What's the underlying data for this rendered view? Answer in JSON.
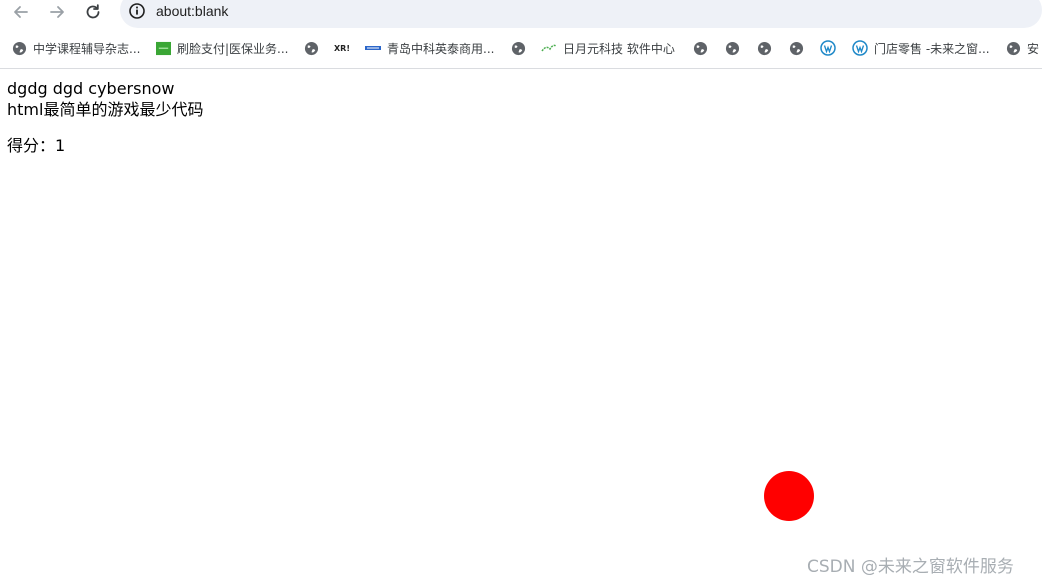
{
  "browser": {
    "url": "about:blank",
    "bookmarks": [
      {
        "label": "中学课程辅导杂志...",
        "icon": "globe-icon"
      },
      {
        "label": "刷脸支付|医保业务...",
        "icon": "green-square-icon"
      },
      {
        "label": "",
        "icon": "globe-icon"
      },
      {
        "label": "",
        "icon": "xr-icon"
      },
      {
        "label": "青岛中科英泰商用...",
        "icon": "wintec-icon"
      },
      {
        "label": "",
        "icon": "globe-icon"
      },
      {
        "label": "日月元科技 软件中心",
        "icon": "leaf-icon"
      },
      {
        "label": "",
        "icon": "globe-icon"
      },
      {
        "label": "",
        "icon": "globe-icon"
      },
      {
        "label": "",
        "icon": "globe-icon"
      },
      {
        "label": "",
        "icon": "globe-icon"
      },
      {
        "label": "",
        "icon": "wordpress-icon"
      },
      {
        "label": "门店零售 -未来之窗...",
        "icon": "wordpress-icon"
      },
      {
        "label": "安",
        "icon": "globe-icon"
      }
    ],
    "xr_text": "XR!"
  },
  "page": {
    "line1": "dgdg dgd cybersnow",
    "line2": "html最简单的游戏最少代码",
    "score_label": "得分：1"
  },
  "game": {
    "ball_color": "#ff0000"
  },
  "watermark": "CSDN @未来之窗软件服务"
}
